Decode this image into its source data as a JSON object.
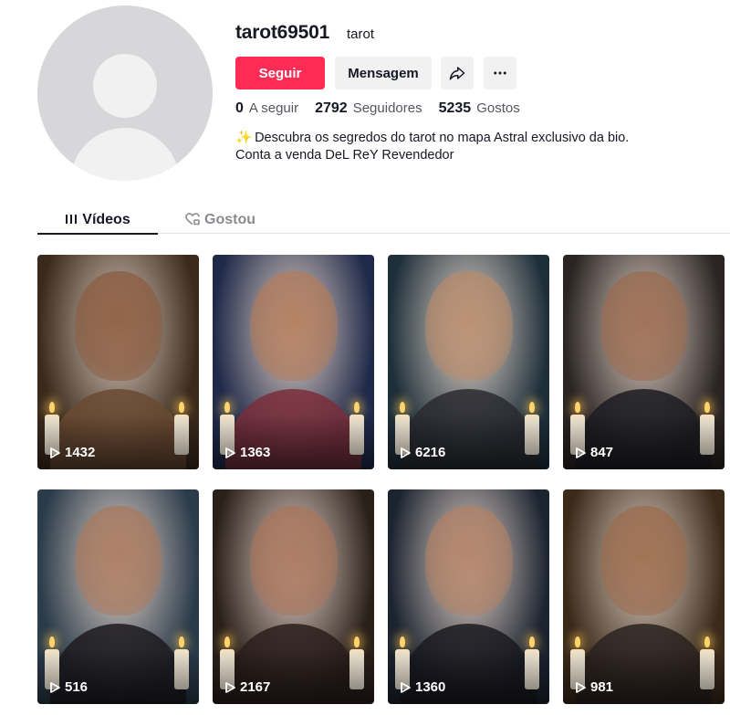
{
  "profile": {
    "username": "tarot69501",
    "nickname": "tarot",
    "follow_label": "Seguir",
    "message_label": "Mensagem",
    "stats": {
      "following_count": "0",
      "following_label": "A seguir",
      "followers_count": "2792",
      "followers_label": "Seguidores",
      "likes_count": "5235",
      "likes_label": "Gostos"
    },
    "bio_line1": "Descubra os segredos do tarot no mapa Astral exclusivo da bio.",
    "bio_line2": "Conta a venda DeL ReY Revendedor"
  },
  "tabs": {
    "videos_label": "Vídeos",
    "liked_label": "Gostou"
  },
  "videos": [
    {
      "views": "1432",
      "bg": "#3a2a1c",
      "skin": "#8a5a3c",
      "cloth": "#6b4a32"
    },
    {
      "views": "1363",
      "bg": "#1f2a4a",
      "skin": "#b07a5a",
      "cloth": "#7a2e3a"
    },
    {
      "views": "6216",
      "bg": "#1e2f3a",
      "skin": "#b68a6a",
      "cloth": "#2a2a30"
    },
    {
      "views": "847",
      "bg": "#2a2422",
      "skin": "#9a6a4e",
      "cloth": "#1c1c22"
    },
    {
      "views": "516",
      "bg": "#2a3b4a",
      "skin": "#a8785c",
      "cloth": "#1c1a1e"
    },
    {
      "views": "2167",
      "bg": "#2a201a",
      "skin": "#a8745a",
      "cloth": "#2a1e1c"
    },
    {
      "views": "1360",
      "bg": "#1c2430",
      "skin": "#b08064",
      "cloth": "#1a1a20"
    },
    {
      "views": "981",
      "bg": "#3a2a1a",
      "skin": "#9a6a4a",
      "cloth": "#2a2220"
    }
  ],
  "colors": {
    "accent": "#fe2c55",
    "text_primary": "#161823",
    "text_secondary": "#545660",
    "button_gray": "#f1f1f2"
  }
}
